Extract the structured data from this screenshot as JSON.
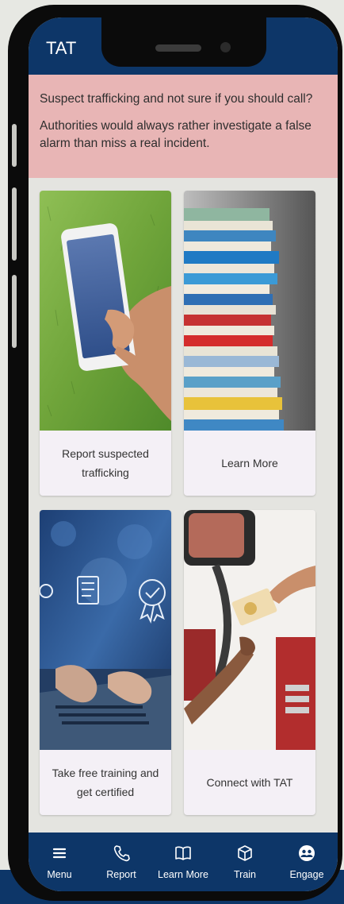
{
  "app": {
    "title": "TAT"
  },
  "alert": {
    "line1": "Suspect trafficking and not sure if you should call?",
    "line2": "Authorities would always rather investigate a false alarm than miss a real incident."
  },
  "cards": [
    {
      "label": "Report suspected trafficking",
      "image": "phone-in-hand-image"
    },
    {
      "label": "Learn More",
      "image": "book-stack-image"
    },
    {
      "label": "Take free training and get certified",
      "image": "laptop-training-image"
    },
    {
      "label": "Connect with TAT",
      "image": "truck-card-handoff-image"
    }
  ],
  "nav": [
    {
      "label": "Menu",
      "icon": "menu-icon"
    },
    {
      "label": "Report",
      "icon": "phone-icon"
    },
    {
      "label": "Learn More",
      "icon": "book-icon"
    },
    {
      "label": "Train",
      "icon": "cube-icon"
    },
    {
      "label": "Engage",
      "icon": "group-icon"
    }
  ],
  "colors": {
    "header": "#0d3668",
    "alert_bg": "#e8b5b5",
    "card_bg": "#f4f0f6",
    "screen_bg": "#e4e4e0"
  }
}
